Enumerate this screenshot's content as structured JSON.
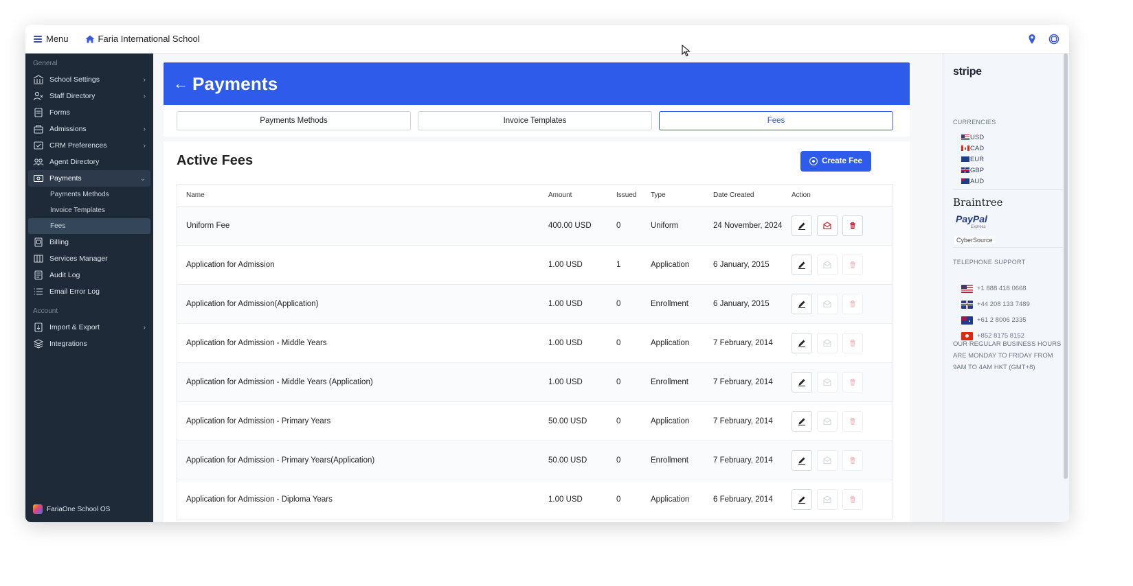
{
  "topbar": {
    "menu_label": "Menu",
    "school_name": "Faria International School",
    "icons": [
      "location-pin-icon",
      "globe-icon"
    ]
  },
  "sidebar": {
    "section_general": "General",
    "section_account": "Account",
    "items": [
      {
        "label": "School Settings",
        "icon": "school-icon",
        "has_chevron": true
      },
      {
        "label": "Staff Directory",
        "icon": "staff-icon",
        "has_chevron": true
      },
      {
        "label": "Forms",
        "icon": "forms-icon",
        "has_chevron": false
      },
      {
        "label": "Admissions",
        "icon": "admissions-icon",
        "has_chevron": true
      },
      {
        "label": "CRM Preferences",
        "icon": "crm-icon",
        "has_chevron": true
      },
      {
        "label": "Agent Directory",
        "icon": "agent-icon",
        "has_chevron": false
      },
      {
        "label": "Payments",
        "icon": "payments-icon",
        "has_chevron": true,
        "expanded": true
      }
    ],
    "payments_sub": [
      "Payments Methods",
      "Invoice Templates",
      "Fees"
    ],
    "items_after": [
      {
        "label": "Billing",
        "icon": "billing-icon"
      },
      {
        "label": "Services Manager",
        "icon": "services-icon"
      },
      {
        "label": "Audit Log",
        "icon": "audit-icon"
      },
      {
        "label": "Email Error Log",
        "icon": "email-log-icon"
      }
    ],
    "account_items": [
      {
        "label": "Import & Export",
        "icon": "import-export-icon",
        "has_chevron": true
      },
      {
        "label": "Integrations",
        "icon": "integrations-icon",
        "has_chevron": false
      }
    ],
    "footer": "FariaOne School OS"
  },
  "main": {
    "title": "Payments",
    "tabs": [
      "Payments Methods",
      "Invoice Templates",
      "Fees"
    ],
    "active_tab": "Fees",
    "section_title": "Active Fees",
    "create_button": "Create Fee",
    "table": {
      "headers": [
        "Name",
        "Amount",
        "Issued",
        "Type",
        "Date Created",
        "Action"
      ],
      "rows": [
        {
          "name": "Uniform Fee",
          "amount": "400.00 USD",
          "issued": "0",
          "type": "Uniform",
          "date": "24 November, 2024",
          "actions_enabled": true
        },
        {
          "name": "Application for Admission",
          "amount": "1.00 USD",
          "issued": "1",
          "type": "Application",
          "date": "6 January, 2015",
          "actions_enabled": false
        },
        {
          "name": "Application for Admission(Application)",
          "amount": "1.00 USD",
          "issued": "0",
          "type": "Enrollment",
          "date": "6 January, 2015",
          "actions_enabled": false
        },
        {
          "name": "Application for Admission - Middle Years",
          "amount": "1.00 USD",
          "issued": "0",
          "type": "Application",
          "date": "7 February, 2014",
          "actions_enabled": false
        },
        {
          "name": "Application for Admission - Middle Years (Application)",
          "amount": "1.00 USD",
          "issued": "0",
          "type": "Enrollment",
          "date": "7 February, 2014",
          "actions_enabled": false
        },
        {
          "name": "Application for Admission - Primary Years",
          "amount": "50.00 USD",
          "issued": "0",
          "type": "Application",
          "date": "7 February, 2014",
          "actions_enabled": false
        },
        {
          "name": "Application for Admission - Primary Years(Application)",
          "amount": "50.00 USD",
          "issued": "0",
          "type": "Enrollment",
          "date": "7 February, 2014",
          "actions_enabled": false
        },
        {
          "name": "Application for Admission - Diploma Years",
          "amount": "1.00 USD",
          "issued": "0",
          "type": "Application",
          "date": "6 February, 2014",
          "actions_enabled": false
        }
      ]
    }
  },
  "right_panel": {
    "stripe": "stripe",
    "currencies_label": "CURRENCIES",
    "currencies": [
      "USD",
      "CAD",
      "EUR",
      "GBP",
      "AUD"
    ],
    "braintree": "Braintree",
    "paypal": "PayPal",
    "paypal_sub": "Express",
    "cybersource": "CyberSource",
    "telephone_label": "TELEPHONE SUPPORT",
    "phones": [
      "+1 888 418 0668",
      "+44 208 133 7489",
      "+61 2 8006 2335",
      "+852 8175 8152"
    ],
    "hours": "Our regular business hours are Monday to Friday from 9am to 4am HKT (GMT+8)"
  },
  "colors": {
    "primary": "#2f5bea",
    "sidebar_bg": "#1e2a38",
    "delete_red": "#c8283c"
  }
}
